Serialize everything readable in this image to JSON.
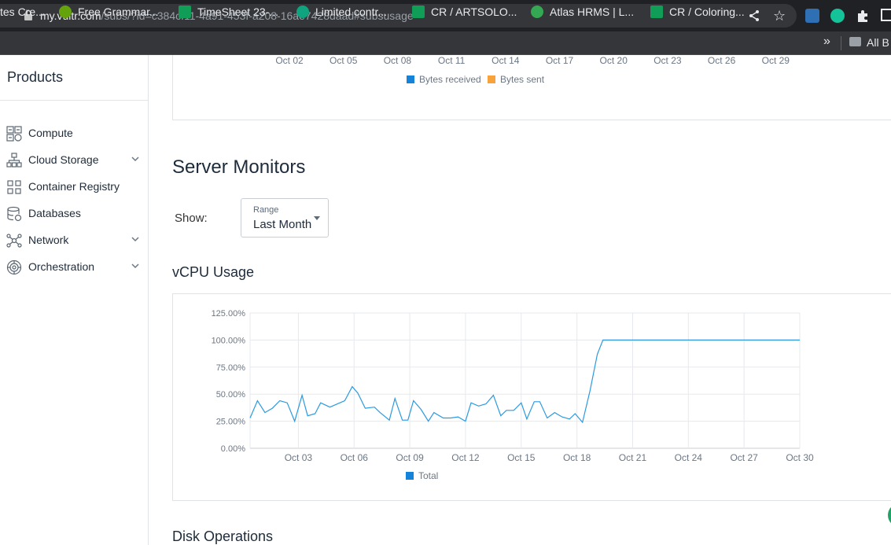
{
  "browser": {
    "url_host": "my.vultr.com",
    "url_path": "/subs/?id=c384cf11-4a91-453f-a208-16ae7428daad#subsusage",
    "bookmarks": [
      {
        "label": "tes Cre...",
        "color": "#202124"
      },
      {
        "label": "Free Grammar...",
        "color": "#65a30d"
      },
      {
        "label": "TimeSheet 23-...",
        "color": "#0f9d58"
      },
      {
        "label": "Limited contr...",
        "color": "#10a37f"
      },
      {
        "label": "CR / ARTSOLO...",
        "color": "#0f9d58"
      },
      {
        "label": "Atlas HRMS | L...",
        "color": "#34a853"
      },
      {
        "label": "CR / Coloring...",
        "color": "#0f9d58"
      }
    ],
    "bookmarks_more": "»",
    "all_bookmarks": "All B"
  },
  "sidebar": {
    "title": "Products",
    "items": [
      {
        "label": "Compute",
        "icon": "compute-icon",
        "expandable": false
      },
      {
        "label": "Cloud Storage",
        "icon": "cloud-storage-icon",
        "expandable": true
      },
      {
        "label": "Container Registry",
        "icon": "container-registry-icon",
        "expandable": false
      },
      {
        "label": "Databases",
        "icon": "databases-icon",
        "expandable": false
      },
      {
        "label": "Network",
        "icon": "network-icon",
        "expandable": true
      },
      {
        "label": "Orchestration",
        "icon": "orchestration-icon",
        "expandable": true
      }
    ]
  },
  "main": {
    "server_monitors_title": "Server Monitors",
    "show_label": "Show:",
    "range": {
      "label": "Range",
      "value": "Last Month"
    },
    "vcpu_title": "vCPU Usage",
    "disk_title": "Disk Operations"
  },
  "colors": {
    "blue": "#1583d9",
    "orange": "#f7a23b",
    "line": "#2b9ae0"
  },
  "chart_data": [
    {
      "type": "bar",
      "title": "",
      "partially_visible": true,
      "y_tick_labels_visible": [
        "0"
      ],
      "x_tick_labels": [
        "Oct 02",
        "Oct 05",
        "Oct 08",
        "Oct 11",
        "Oct 14",
        "Oct 17",
        "Oct 20",
        "Oct 23",
        "Oct 26",
        "Oct 29"
      ],
      "series": [
        {
          "name": "Bytes received",
          "color": "#1583d9"
        },
        {
          "name": "Bytes sent",
          "color": "#f7a23b"
        }
      ],
      "legend": "bottom-center"
    },
    {
      "type": "line",
      "title": "vCPU Usage",
      "y_tick_labels": [
        "0.00%",
        "25.00%",
        "50.00%",
        "75.00%",
        "100.00%",
        "125.00%"
      ],
      "ylim": [
        0,
        125
      ],
      "x_tick_labels": [
        "Oct 03",
        "Oct 06",
        "Oct 09",
        "Oct 12",
        "Oct 15",
        "Oct 18",
        "Oct 21",
        "Oct 24",
        "Oct 27",
        "Oct 30"
      ],
      "x_range_days": [
        0.4,
        30.0
      ],
      "grid": true,
      "legend": "bottom-center",
      "series": [
        {
          "name": "Total",
          "color": "#2b9ae0",
          "points": [
            [
              0.4,
              28
            ],
            [
              0.8,
              44
            ],
            [
              1.2,
              33
            ],
            [
              1.6,
              37
            ],
            [
              2.0,
              44
            ],
            [
              2.4,
              42
            ],
            [
              2.8,
              25
            ],
            [
              3.2,
              49
            ],
            [
              3.5,
              30
            ],
            [
              3.9,
              32
            ],
            [
              4.2,
              42
            ],
            [
              4.7,
              38
            ],
            [
              5.1,
              41
            ],
            [
              5.5,
              44
            ],
            [
              5.9,
              57
            ],
            [
              6.2,
              51
            ],
            [
              6.6,
              37
            ],
            [
              7.1,
              38
            ],
            [
              7.4,
              33
            ],
            [
              7.9,
              26
            ],
            [
              8.2,
              46
            ],
            [
              8.6,
              26
            ],
            [
              8.9,
              26
            ],
            [
              9.2,
              44
            ],
            [
              9.6,
              36
            ],
            [
              10.0,
              25
            ],
            [
              10.3,
              33
            ],
            [
              10.8,
              28
            ],
            [
              11.2,
              28
            ],
            [
              11.6,
              29
            ],
            [
              12.0,
              25
            ],
            [
              12.3,
              42
            ],
            [
              12.7,
              39
            ],
            [
              13.1,
              41
            ],
            [
              13.5,
              49
            ],
            [
              13.9,
              30
            ],
            [
              14.2,
              35
            ],
            [
              14.6,
              35
            ],
            [
              15.0,
              42
            ],
            [
              15.3,
              27
            ],
            [
              15.7,
              43
            ],
            [
              16.0,
              43
            ],
            [
              16.4,
              28
            ],
            [
              16.8,
              33
            ],
            [
              17.2,
              29
            ],
            [
              17.6,
              27
            ],
            [
              17.9,
              32
            ],
            [
              18.3,
              24
            ],
            [
              18.7,
              53
            ],
            [
              19.1,
              87
            ],
            [
              19.4,
              100
            ],
            [
              21.0,
              100
            ],
            [
              24.0,
              100
            ],
            [
              27.0,
              100
            ],
            [
              30.0,
              100
            ]
          ]
        }
      ]
    }
  ]
}
